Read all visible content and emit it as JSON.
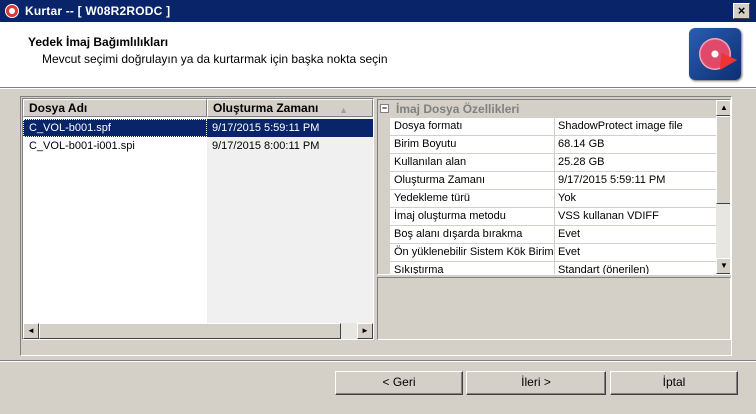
{
  "window": {
    "title": "Kurtar -- [ W08R2RODC ]",
    "close_glyph": "×"
  },
  "header": {
    "title": "Yedek İmaj Bağımlılıkları",
    "subtitle": "Mevcut seçimi doğrulayın ya da kurtarmak için başka nokta seçin",
    "icon": "restore-disc-icon"
  },
  "file_list": {
    "columns": [
      "Dosya Adı",
      "Oluşturma Zamanı"
    ],
    "sort_indicator": "▲",
    "rows": [
      {
        "name": "C_VOL-b001.spf",
        "created": "9/17/2015 5:59:11 PM",
        "selected": true
      },
      {
        "name": "C_VOL-b001-i001.spi",
        "created": "9/17/2015 8:00:11 PM",
        "selected": false
      }
    ],
    "scroll_left_glyph": "◄",
    "scroll_right_glyph": "►"
  },
  "properties": {
    "category_toggle": "−",
    "category": "İmaj Dosya Özellikleri",
    "rows": [
      {
        "name": "Dosya formatı",
        "value": "ShadowProtect image file"
      },
      {
        "name": "Birim Boyutu",
        "value": "68.14 GB"
      },
      {
        "name": "Kullanılan alan",
        "value": "25.28 GB"
      },
      {
        "name": "Oluşturma Zamanı",
        "value": "9/17/2015 5:59:11 PM"
      },
      {
        "name": "Yedekleme türü",
        "value": "Yok"
      },
      {
        "name": "İmaj oluşturma metodu",
        "value": "VSS kullanan VDIFF"
      },
      {
        "name": "Boş alanı dışarda bırakma",
        "value": "Evet"
      },
      {
        "name": "Ön yüklenebilir Sistem Kök Birim",
        "value": "Evet"
      },
      {
        "name": "Sıkıştırma",
        "value": "Standart (önerilen)"
      }
    ],
    "scroll_up_glyph": "▲",
    "scroll_down_glyph": "▼"
  },
  "buttons": {
    "back": "< Geri",
    "next": "İleri >",
    "cancel": "İptal"
  }
}
